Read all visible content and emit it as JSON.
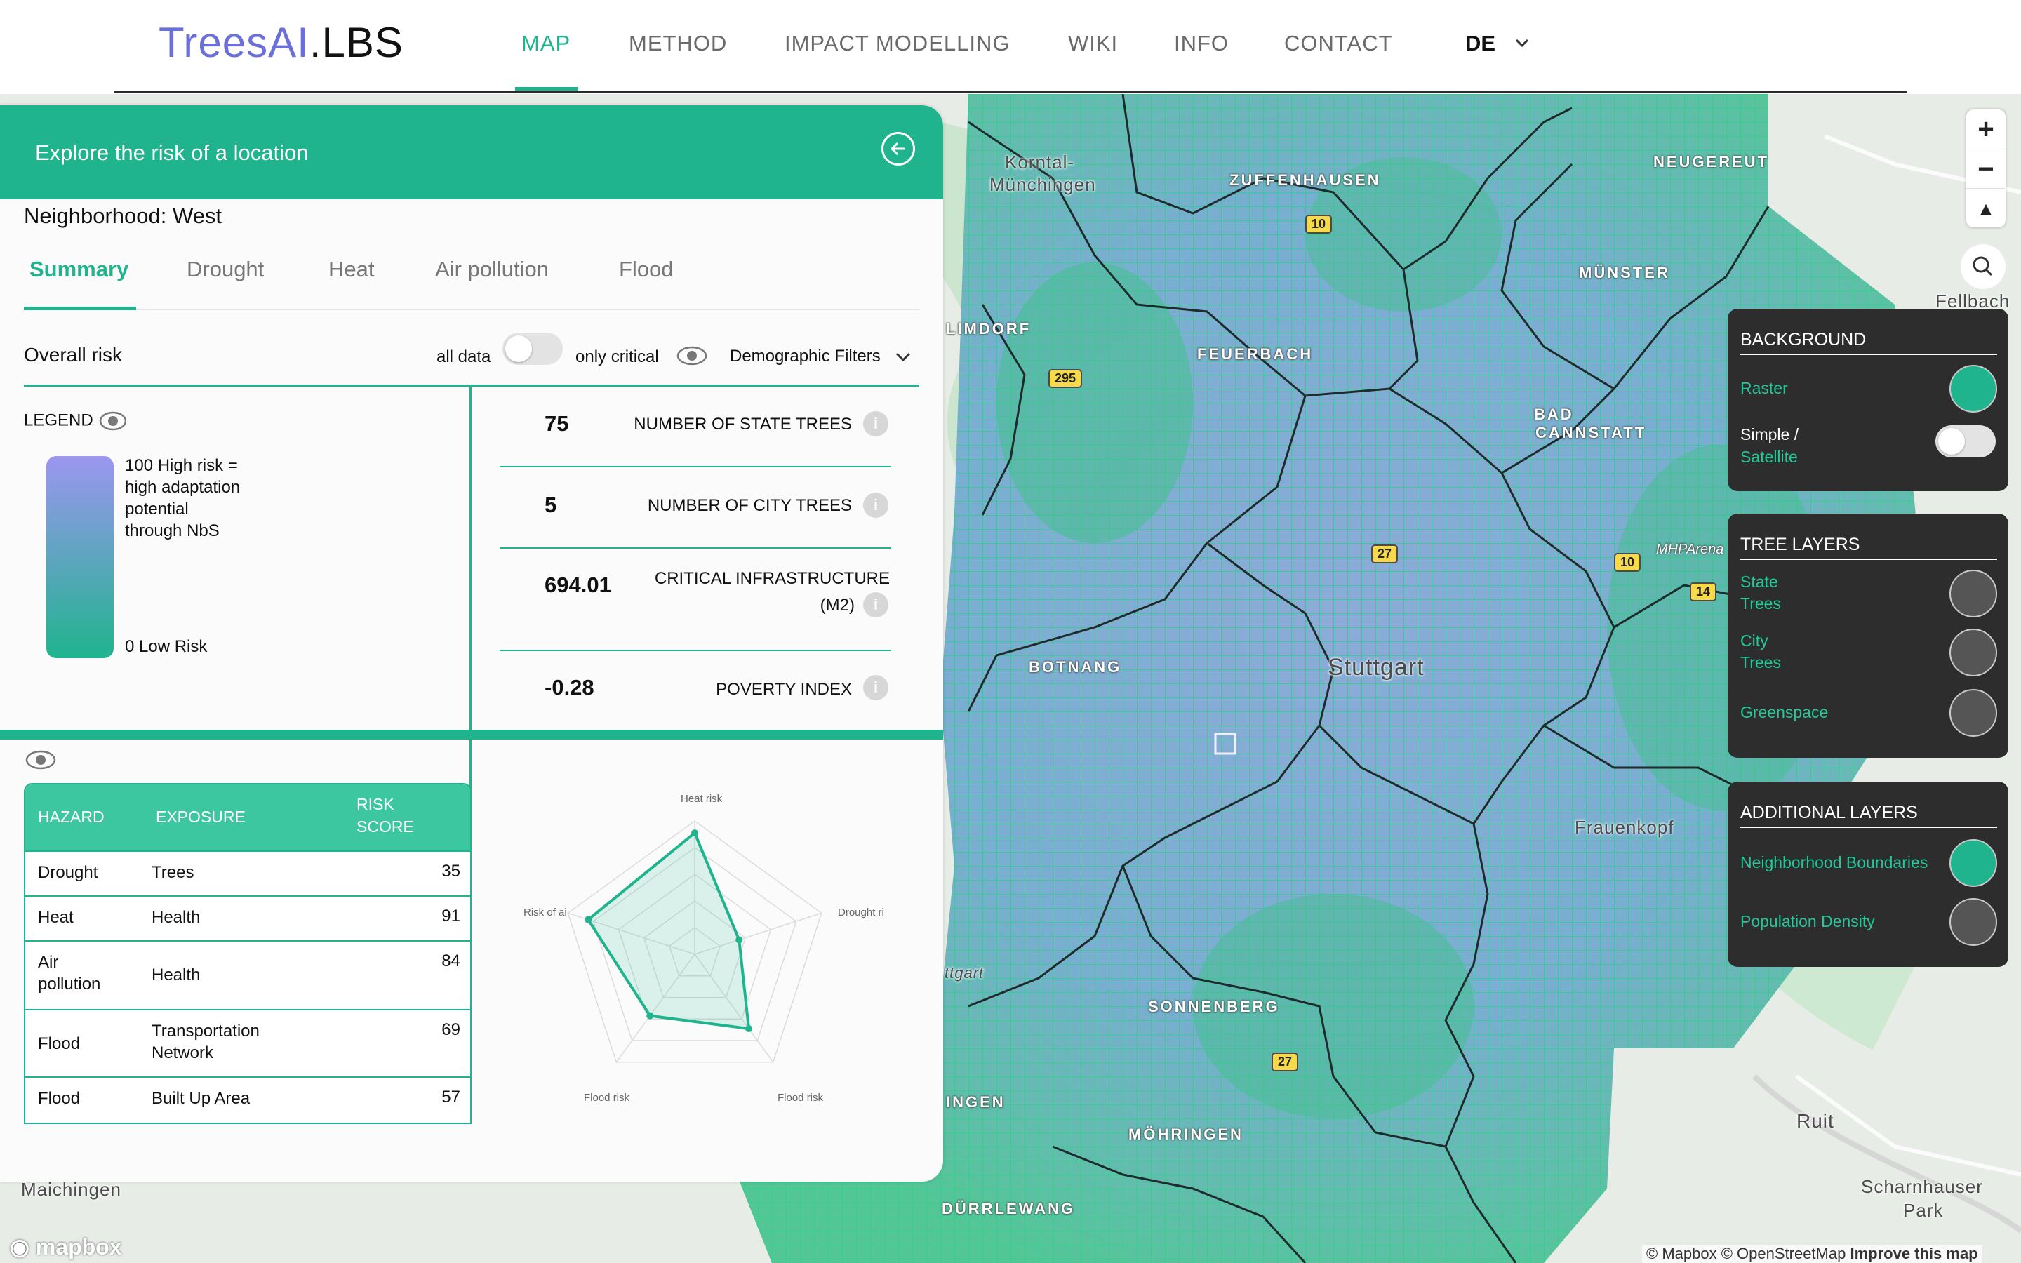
{
  "header": {
    "logo": {
      "part1": "TreesAI",
      "part2": ".LBS"
    },
    "nav": [
      "MAP",
      "METHOD",
      "IMPACT MODELLING",
      "WIKI",
      "INFO",
      "CONTACT"
    ],
    "language": "DE"
  },
  "panel": {
    "title": "Explore the risk of a location",
    "neighborhood": "Neighborhood: West",
    "tabs": [
      "Summary",
      "Drought",
      "Heat",
      "Air pollution",
      "Flood"
    ],
    "overall_label": "Overall risk",
    "all_data": "all data",
    "only_critical": "only critical",
    "filters": "Demographic Filters",
    "legend": {
      "label": "LEGEND",
      "high_text_1": "100 High risk =",
      "high_text_2": "high adaptation",
      "high_text_3": "potential",
      "high_text_4": "through NbS",
      "low_text": "0 Low Risk"
    },
    "stats": [
      {
        "value": "75",
        "label": "NUMBER OF STATE TREES"
      },
      {
        "value": "5",
        "label": "NUMBER OF CITY TREES"
      },
      {
        "value": "694.01",
        "label_line1": "CRITICAL INFRASTRUCTURE",
        "label_line2": "(M2)"
      },
      {
        "value": "-0.28",
        "label": "POVERTY INDEX"
      }
    ],
    "table": {
      "headers": [
        "HAZARD",
        "EXPOSURE",
        "RISK",
        "SCORE"
      ],
      "rows": [
        {
          "hazard": "Drought",
          "exposure": "Trees",
          "score": "35"
        },
        {
          "hazard": "Heat",
          "exposure": "Health",
          "score": "91"
        },
        {
          "hazard_1": "Air",
          "hazard_2": "pollution",
          "exposure": "Health",
          "score": "84"
        },
        {
          "hazard": "Flood",
          "exposure_1": "Transportation",
          "exposure_2": "Network",
          "score": "69"
        },
        {
          "hazard": "Flood",
          "exposure": "Built Up Area",
          "score": "57"
        }
      ]
    },
    "radar": {
      "axes": [
        "Heat risk",
        "Drought ri",
        "Flood risk",
        "Flood risk",
        "Risk of ai"
      ],
      "values": [
        91,
        35,
        69,
        57,
        84
      ],
      "max": 100
    }
  },
  "map_labels": {
    "korntal_1": "Korntal-",
    "korntal_2": "Münchingen",
    "zuffenhausen": "ZUFFENHAUSEN",
    "neugereut": "NEUGEREUT",
    "muenster": "MÜNSTER",
    "fellbach": "Fellbach",
    "limdorf": "LIMDORF",
    "feuerbach": "FEUERBACH",
    "bad_1": "BAD",
    "bad_2": "CANNSTATT",
    "mhp": "MHPArena",
    "botnang": "BOTNANG",
    "stuttgart": "Stuttgart",
    "frauenkopf": "Frauenkopf",
    "ttgart": "ttgart",
    "sonnenberg": "SONNENBERG",
    "ingen": "INGEN",
    "moehringen": "MÖHRINGEN",
    "duerrlewang": "DÜRRLEWANG",
    "maichingen": "Maichingen",
    "ruit": "Ruit",
    "scharn_1": "Scharnhauser",
    "scharn_2": "Park",
    "roads": [
      "10",
      "295",
      "27",
      "10",
      "14",
      "27"
    ]
  },
  "controls": {
    "background": {
      "title": "BACKGROUND",
      "raster": "Raster",
      "simple": "Simple /",
      "satellite": "Satellite"
    },
    "tree_layers": {
      "title": "TREE LAYERS",
      "state_1": "State",
      "state_2": "Trees",
      "city_1": "City",
      "city_2": "Trees",
      "greenspace": "Greenspace"
    },
    "additional": {
      "title": "ADDITIONAL LAYERS",
      "neighborhood": "Neighborhood Boundaries",
      "population": "Population Density"
    }
  },
  "attribution": {
    "mapbox": "mapbox",
    "credits": "© Mapbox © OpenStreetMap",
    "improve": "Improve this map"
  },
  "colors": {
    "accent": "#1fb48e",
    "risk_high": "#9c96ef",
    "risk_low": "#1fb48e"
  }
}
